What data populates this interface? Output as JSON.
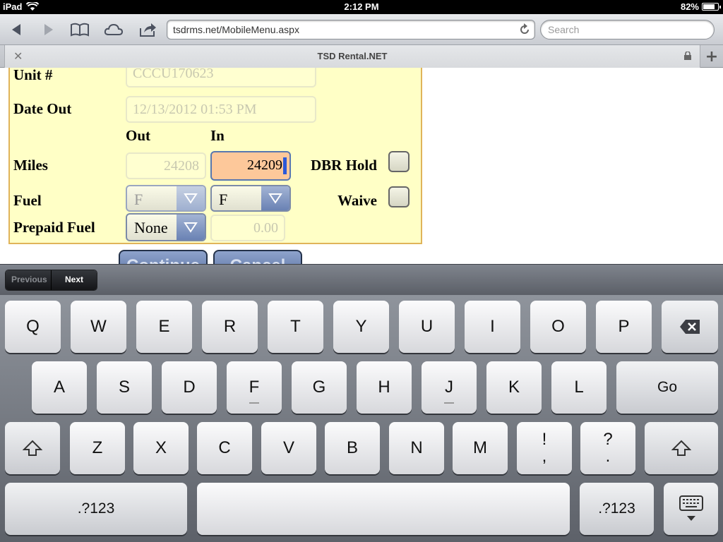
{
  "status": {
    "device": "iPad",
    "time": "2:12 PM",
    "battery_percent": "82%",
    "battery_level": 0.82
  },
  "browser": {
    "url": "tsdrms.net/MobileMenu.aspx",
    "search_placeholder": "Search",
    "tab_title": "TSD Rental.NET"
  },
  "form": {
    "unit_label": "Unit #",
    "unit_value": "CCCU170623",
    "date_out_label": "Date Out",
    "date_out_value": "12/13/2012 01:53 PM",
    "col_out": "Out",
    "col_in": "In",
    "miles_label": "Miles",
    "miles_out": "24208",
    "miles_in": "24209",
    "dbr_hold_label": "DBR Hold",
    "fuel_label": "Fuel",
    "fuel_out": "F",
    "fuel_in": "F",
    "waive_label": "Waive",
    "prepaid_fuel_label": "Prepaid Fuel",
    "prepaid_fuel_value": "None",
    "prepaid_amount": "0.00",
    "continue_label": "Continue",
    "cancel_label": "Cancel"
  },
  "accessory": {
    "previous_label": "Previous",
    "next_label": "Next"
  },
  "keyboard": {
    "row1": [
      "Q",
      "W",
      "E",
      "R",
      "T",
      "Y",
      "U",
      "I",
      "O",
      "P"
    ],
    "row2": [
      "A",
      "S",
      "D",
      "F",
      "G",
      "H",
      "J",
      "K",
      "L"
    ],
    "go_label": "Go",
    "row3": [
      "Z",
      "X",
      "C",
      "V",
      "B",
      "N",
      "M"
    ],
    "excl_top": "!",
    "excl_bottom": ",",
    "q_top": "?",
    "q_bottom": ".",
    "numbers_label": ".?123"
  }
}
